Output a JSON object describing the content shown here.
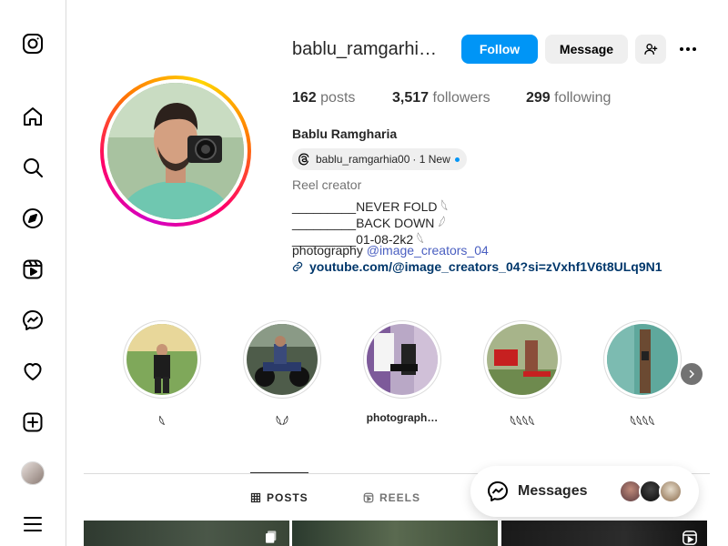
{
  "sidebar": {
    "items": [
      {
        "name": "instagram-logo",
        "icon": "instagram-icon"
      },
      {
        "name": "home",
        "icon": "home-icon"
      },
      {
        "name": "search",
        "icon": "search-icon"
      },
      {
        "name": "explore",
        "icon": "compass-icon"
      },
      {
        "name": "reels",
        "icon": "reels-icon"
      },
      {
        "name": "messenger",
        "icon": "messenger-icon"
      },
      {
        "name": "notifications",
        "icon": "heart-icon"
      },
      {
        "name": "create",
        "icon": "plus-square-icon"
      },
      {
        "name": "profile",
        "icon": "avatar"
      },
      {
        "name": "more",
        "icon": "menu-icon"
      }
    ]
  },
  "profile": {
    "username": "bablu_ramgarhia00",
    "follow_label": "Follow",
    "message_label": "Message",
    "stats": {
      "posts_count": "162",
      "posts_label": "posts",
      "followers_count": "3,517",
      "followers_label": "followers",
      "following_count": "299",
      "following_label": "following"
    },
    "full_name": "Bablu Ramgharia",
    "threads": {
      "handle": "bablu_ramgarhia00",
      "new_label": "· 1 New"
    },
    "category": "Reel creator",
    "bio": {
      "line1": "_________NEVER FOLD 𓆩",
      "line2": "_________BACK DOWN 𓆪",
      "line3": "_________01-08-2k2 𓆩",
      "line4_prefix": "photography ",
      "line4_tag": "@image_creators_04"
    },
    "link": "youtube.com/@image_creators_04?si=zVxhf1V6t8ULq9N1"
  },
  "highlights": [
    {
      "label": "𓆩"
    },
    {
      "label": "𓆩𓆪"
    },
    {
      "label": "photograph…"
    },
    {
      "label": "𓆩𓆩𓆩𓆩"
    },
    {
      "label": "𓆩𓆩𓆩𓆩"
    }
  ],
  "tabs": {
    "posts": "POSTS",
    "reels": "REELS"
  },
  "messages": {
    "label": "Messages"
  },
  "colors": {
    "accent": "#0095f6",
    "text": "#262626",
    "muted": "#737373",
    "border": "#dbdbdb"
  }
}
